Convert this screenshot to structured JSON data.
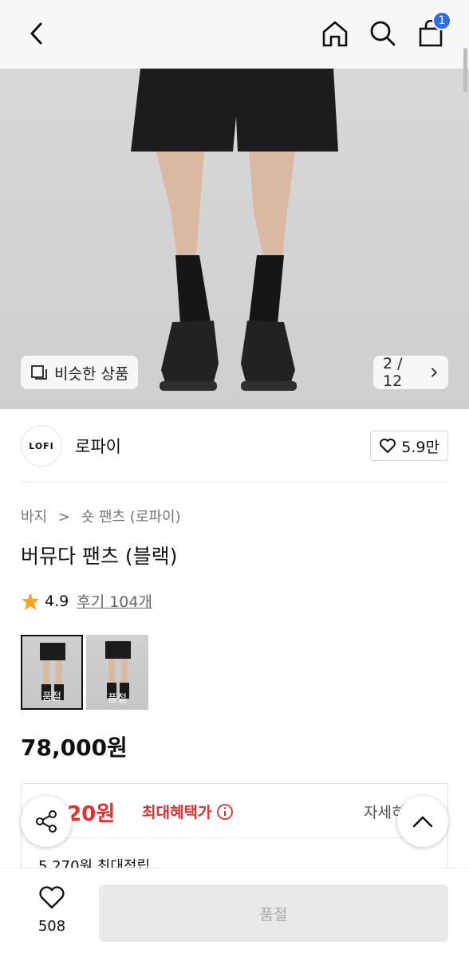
{
  "nav": {
    "back_icon": "chevron-left-icon",
    "home_icon": "home-icon",
    "search_icon": "search-icon",
    "cart_icon": "shopping-bag-icon",
    "cart_count": "1"
  },
  "hero": {
    "similar_label": "비슷한 상품",
    "page_indicator": "2 / 12"
  },
  "brand": {
    "logo_text": "LOFI",
    "name": "로파이",
    "likes": "5.9만"
  },
  "product": {
    "breadcrumb_category": "바지",
    "breadcrumb_sub": "숏 팬츠 (로파이)",
    "title": "버뮤다 팬츠 (블랙)",
    "rating": "4.9",
    "reviews": "후기 104개",
    "price": "78,000원"
  },
  "options": [
    {
      "status": "품절"
    },
    {
      "status": "품절"
    }
  ],
  "benefit": {
    "amount": "320원",
    "label": "최대혜택가",
    "detail": "자세히",
    "points": "5,270원 최대적립"
  },
  "bottom": {
    "wish_count": "508",
    "buy_label": "품절"
  },
  "colors": {
    "accent_red": "#e53030",
    "badge_blue": "#2f6bf0"
  }
}
